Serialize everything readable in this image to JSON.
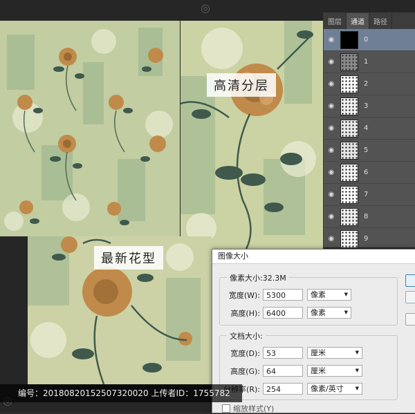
{
  "canvas": {
    "label_top": "高清分层",
    "label_bottom": "最新花型"
  },
  "channels_panel": {
    "tabs": [
      "图层",
      "通道",
      "路径"
    ],
    "active_tab": "通道",
    "channels": [
      "0",
      "1",
      "2",
      "3",
      "4",
      "5",
      "6",
      "7",
      "8",
      "9"
    ],
    "selected": "0"
  },
  "image_size_dialog": {
    "title": "图像大小",
    "pixel_dimensions_label": "像素大小:32.3M",
    "width_label": "宽度(W):",
    "width_value": "5300",
    "width_unit": "像素",
    "height_label": "高度(H):",
    "height_value": "6400",
    "height_unit": "像素",
    "document_size_label": "文档大小:",
    "doc_width_label": "宽度(D):",
    "doc_width_value": "53",
    "doc_width_unit": "厘米",
    "doc_height_label": "高度(G):",
    "doc_height_value": "64",
    "doc_height_unit": "厘米",
    "resolution_label": "分辨率(R):",
    "resolution_value": "254",
    "resolution_unit": "像素/英寸",
    "scale_styles_label": "缩放样式(Y)"
  },
  "footer": {
    "text": "编号：20180820152507320020 上传者ID：1755782"
  },
  "colors": {
    "panel_bg": "#535353",
    "selected_row": "#6f7f95",
    "pattern_base": "#c9cfa5",
    "rose": "#c08b4a",
    "leaf": "#3f5a4c"
  }
}
